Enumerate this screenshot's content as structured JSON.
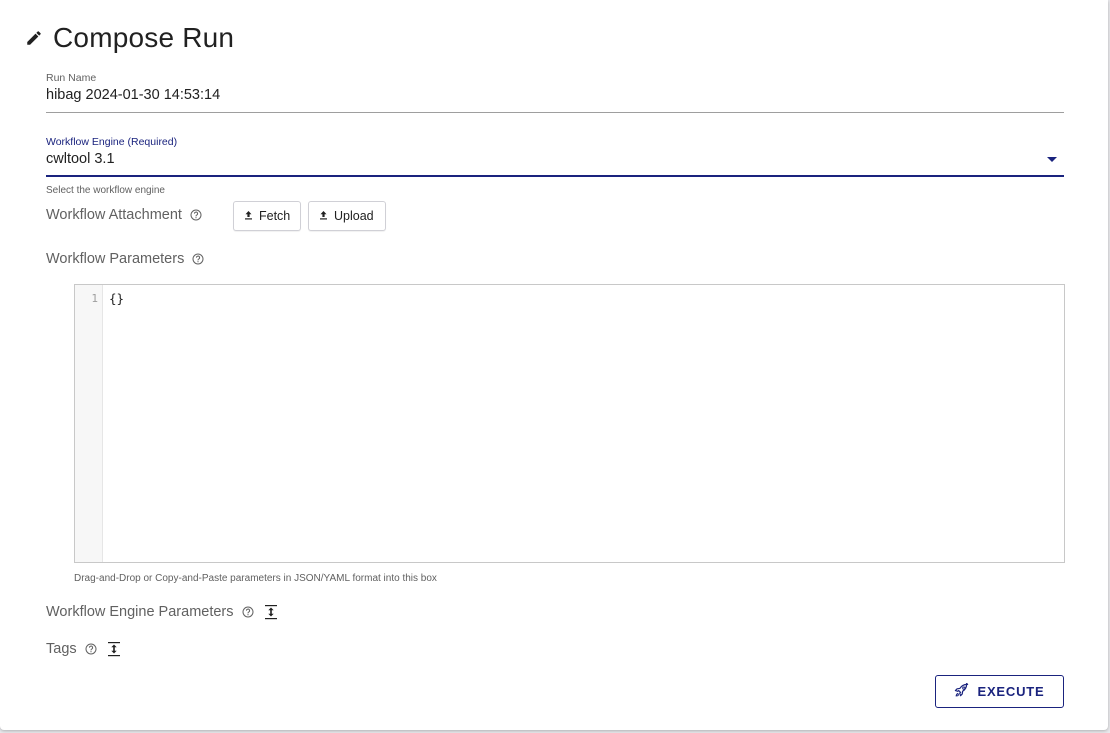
{
  "header": {
    "title": "Compose Run",
    "icon": "pencil-icon"
  },
  "run_name": {
    "label": "Run Name",
    "value": "hibag 2024-01-30 14:53:14"
  },
  "workflow_engine": {
    "label": "Workflow Engine (Required)",
    "value": "cwltool 3.1",
    "helper": "Select the workflow engine"
  },
  "workflow_attachment": {
    "label": "Workflow Attachment",
    "fetch_label": "Fetch",
    "upload_label": "Upload"
  },
  "workflow_parameters": {
    "label": "Workflow Parameters",
    "line_number": "1",
    "content": "{}",
    "helper": "Drag-and-Drop or Copy-and-Paste parameters in JSON/YAML format into this box"
  },
  "workflow_engine_parameters": {
    "label": "Workflow Engine Parameters"
  },
  "tags": {
    "label": "Tags"
  },
  "actions": {
    "execute_label": "EXECUTE"
  },
  "colors": {
    "accent": "#1a237e",
    "muted_text": "#616161"
  }
}
